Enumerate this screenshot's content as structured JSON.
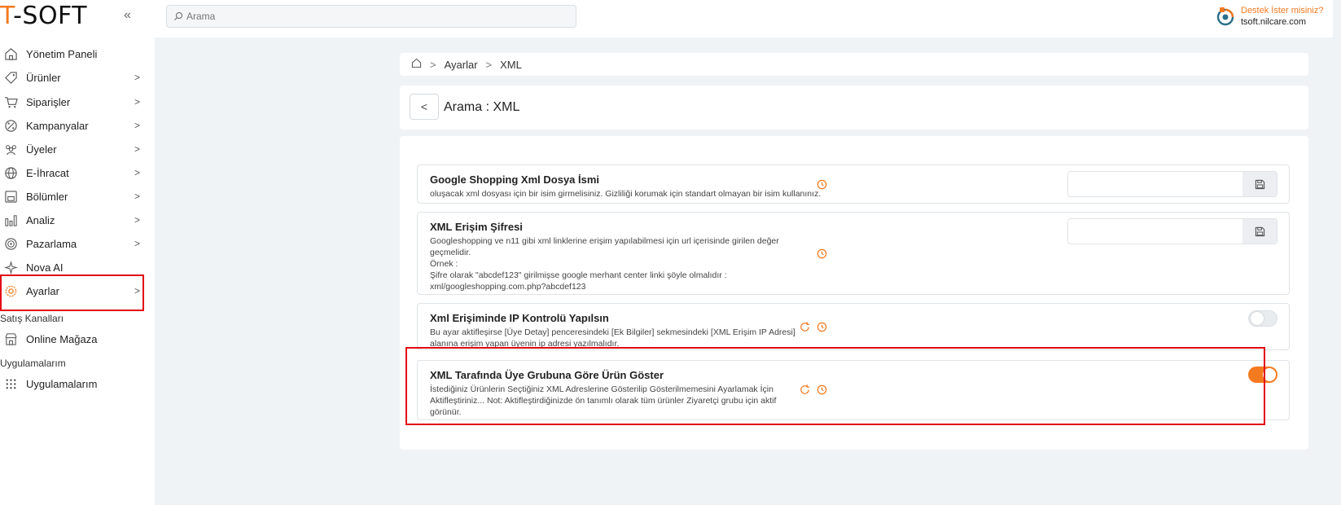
{
  "header": {
    "logo_t": "T",
    "logo_rest": "-SOFT",
    "collapse_icon": "double-chevron-left-icon",
    "search_placeholder": "Arama",
    "support_question": "Destek İster misiniz?",
    "support_domain": "tsoft.nilcare.com"
  },
  "sidebar": {
    "items": [
      {
        "label": "Yönetim Paneli",
        "icon": "home-icon"
      },
      {
        "label": "Ürünler",
        "icon": "tag-icon"
      },
      {
        "label": "Siparişler",
        "icon": "cart-icon"
      },
      {
        "label": "Kampanyalar",
        "icon": "percent-icon"
      },
      {
        "label": "Üyeler",
        "icon": "users-icon"
      },
      {
        "label": "E-İhracat",
        "icon": "globe-icon"
      },
      {
        "label": "Bölümler",
        "icon": "sections-icon"
      },
      {
        "label": "Analiz",
        "icon": "chart-icon"
      },
      {
        "label": "Pazarlama",
        "icon": "target-icon"
      },
      {
        "label": "Nova AI",
        "icon": "sparkle-icon"
      },
      {
        "label": "Ayarlar",
        "icon": "gear-icon"
      }
    ],
    "sections": [
      {
        "title": "Satış Kanalları",
        "item": "Online Mağaza"
      },
      {
        "title": "Uygulamalarım",
        "item": "Uygulamalarım"
      }
    ]
  },
  "breadcrumb": {
    "home_icon": "home-icon",
    "items": [
      "Ayarlar",
      "XML"
    ]
  },
  "page": {
    "title": "Arama : XML"
  },
  "settings": [
    {
      "title": "Google Shopping Xml Dosya İsmi",
      "desc": [
        "oluşacak xml dosyası için bir isim girmelisiniz. Gizliliği korumak için standart olmayan bir isim kullanınız."
      ],
      "control": "input",
      "value": ""
    },
    {
      "title": "XML Erişim Şifresi",
      "desc": [
        "Googleshopping ve n11 gibi xml linklerine erişim yapılabilmesi için url içerisinde girilen değer",
        "geçmelidir.",
        "Örnek :",
        "Şifre olarak \"abcdef123\" girilmişse google merhant center linki şöyle olmalıdır :",
        "xml/googleshopping.com.php?abcdef123"
      ],
      "control": "input",
      "value": ""
    },
    {
      "title": "Xml Erişiminde IP Kontrolü Yapılsın",
      "desc": [
        "Bu ayar aktifleşirse [Üye Detay] penceresindeki [Ek Bilgiler] sekmesindeki [XML Erişim IP Adresi]",
        "alanına erişim yapan üyenin ip adresi yazılmalıdır."
      ],
      "control": "toggle",
      "enabled": false
    },
    {
      "title": "XML Tarafında Üye Grubuna Göre Ürün Göster",
      "desc": [
        "İstediğiniz Ürünlerin Seçtiğiniz XML Adreslerine Gösterilip Gösterilmemesini Ayarlamak İçin",
        "Aktifleştiriniz... Not: Aktifleştirdiğinizde ön tanımlı olarak tüm ürünler Ziyaretçi grubu için aktif",
        "görünür."
      ],
      "control": "toggle",
      "enabled": true
    }
  ],
  "colors": {
    "accent": "#f47a20",
    "highlight": "#e30613",
    "background": "#f0f3f6"
  }
}
